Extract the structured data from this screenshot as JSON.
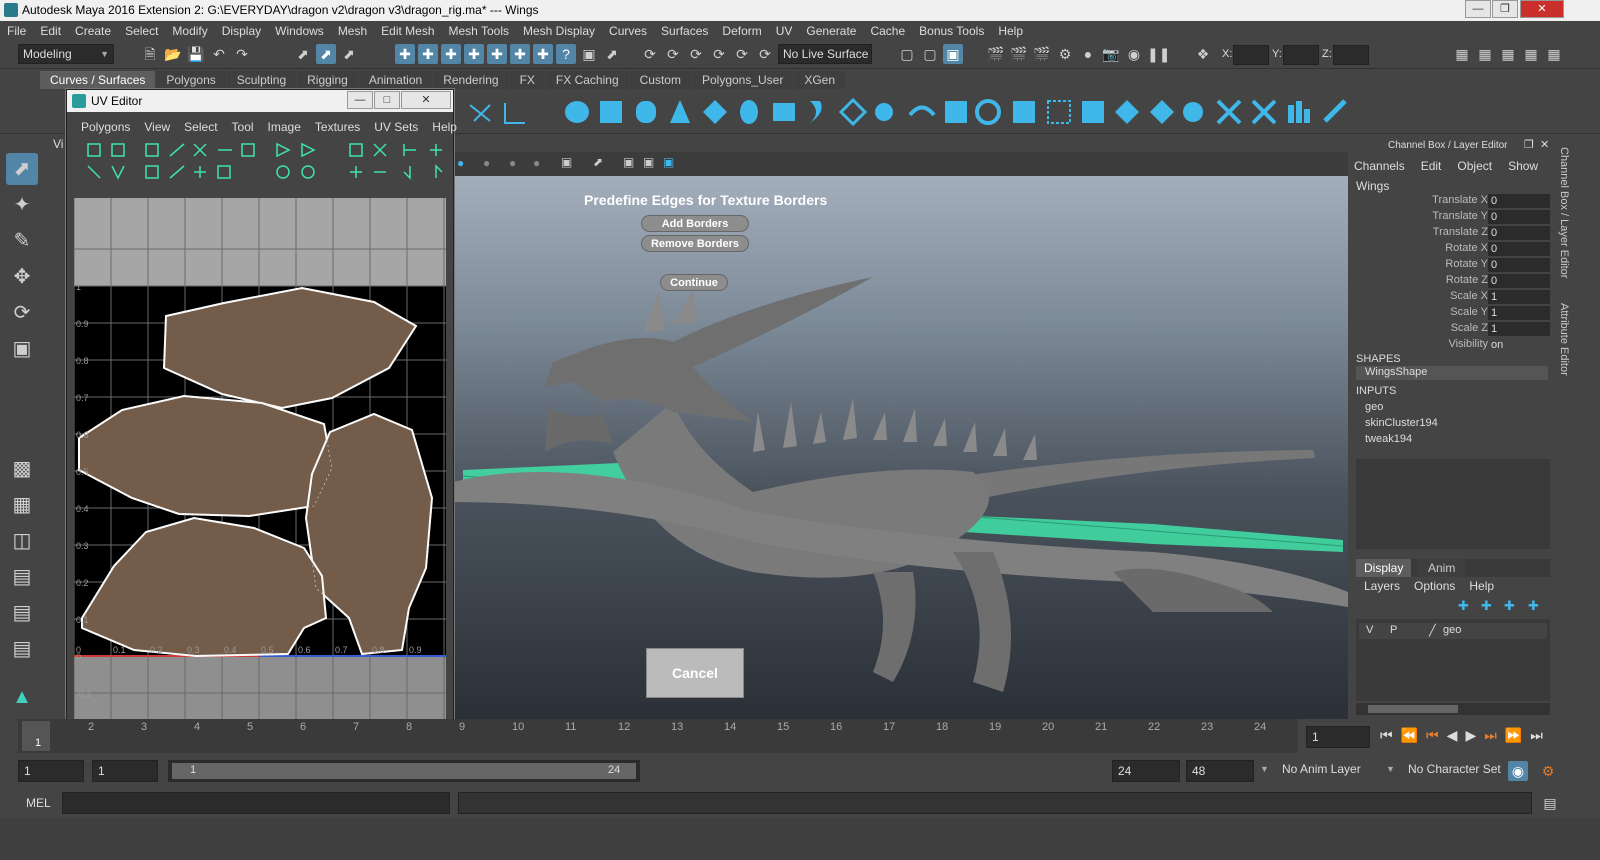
{
  "titlebar": {
    "title": "Autodesk Maya 2016 Extension 2: G:\\EVERYDAY\\dragon v2\\dragon v3\\dragon_rig.ma*   ---   Wings"
  },
  "menubar": [
    "File",
    "Edit",
    "Create",
    "Select",
    "Modify",
    "Display",
    "Windows",
    "Mesh",
    "Edit Mesh",
    "Mesh Tools",
    "Mesh Display",
    "Curves",
    "Surfaces",
    "Deform",
    "UV",
    "Generate",
    "Cache",
    "Bonus Tools",
    "Help"
  ],
  "statusline": {
    "mode": "Modeling",
    "live_surface": "No Live Surface",
    "x_label": "X:",
    "y_label": "Y:",
    "z_label": "Z:"
  },
  "shelf_tabs": [
    "Curves / Surfaces",
    "Polygons",
    "Sculpting",
    "Rigging",
    "Animation",
    "Rendering",
    "FX",
    "FX Caching",
    "Custom",
    "Polygons_User",
    "XGen"
  ],
  "uv_editor": {
    "title": "UV Editor",
    "menu": [
      "Polygons",
      "View",
      "Select",
      "Tool",
      "Image",
      "Textures",
      "UV Sets",
      "Help"
    ],
    "v_labels": [
      "1",
      "0.9",
      "0.8",
      "0.7",
      "0.6",
      "0.5",
      "0.4",
      "0.3",
      "0.2",
      "0.1",
      "0",
      "-0.1",
      "-0.2"
    ],
    "u_labels": [
      "0",
      "0.1",
      "0.2",
      "0.3",
      "0.4",
      "0.5",
      "0.6",
      "0.7",
      "0.8",
      "0.9"
    ]
  },
  "viewport": {
    "menu_label": "Vi",
    "heading": "Predefine Edges for Texture Borders",
    "add_borders": "Add  Borders",
    "remove_borders": "Remove Borders",
    "continue": "Continue",
    "cancel": "Cancel"
  },
  "channel_box": {
    "header": "Channel Box / Layer Editor",
    "menu": [
      "Channels",
      "Edit",
      "Object",
      "Show"
    ],
    "object": "Wings",
    "attributes": [
      {
        "name": "Translate X",
        "value": "0"
      },
      {
        "name": "Translate Y",
        "value": "0"
      },
      {
        "name": "Translate Z",
        "value": "0"
      },
      {
        "name": "Rotate X",
        "value": "0"
      },
      {
        "name": "Rotate Y",
        "value": "0"
      },
      {
        "name": "Rotate Z",
        "value": "0"
      },
      {
        "name": "Scale X",
        "value": "1"
      },
      {
        "name": "Scale Y",
        "value": "1"
      },
      {
        "name": "Scale Z",
        "value": "1"
      },
      {
        "name": "Visibility",
        "value": "on"
      }
    ],
    "shapes_label": "SHAPES",
    "shape": "WingsShape",
    "inputs_label": "INPUTS",
    "inputs": [
      "geo",
      "skinCluster194",
      "tweak194"
    ],
    "layer_tabs": [
      "Display",
      "Anim"
    ],
    "layer_menu": [
      "Layers",
      "Options",
      "Help"
    ],
    "layer": {
      "v": "V",
      "p": "P",
      "name": "geo"
    }
  },
  "side_tabs": [
    "Channel Box / Layer Editor",
    "Attribute Editor"
  ],
  "time_slider": {
    "ticks": [
      "1",
      "2",
      "3",
      "4",
      "5",
      "6",
      "7",
      "8",
      "9",
      "10",
      "11",
      "12",
      "13",
      "14",
      "15",
      "16",
      "17",
      "18",
      "19",
      "20",
      "21",
      "22",
      "23",
      "24"
    ],
    "current_frame_left": "1",
    "current_frame": "1"
  },
  "range_bar": {
    "start": "1",
    "playback_start": "1",
    "range_inner_start": "1",
    "range_inner_end": "24",
    "playback_end": "24",
    "end": "48",
    "anim_layer": "No Anim Layer",
    "character_set": "No Character Set"
  },
  "cmdline": {
    "label": "MEL"
  },
  "colors": {
    "accent": "#5285a6",
    "wire_green": "#3fe3a8",
    "uv_skin": "#735c4a"
  }
}
